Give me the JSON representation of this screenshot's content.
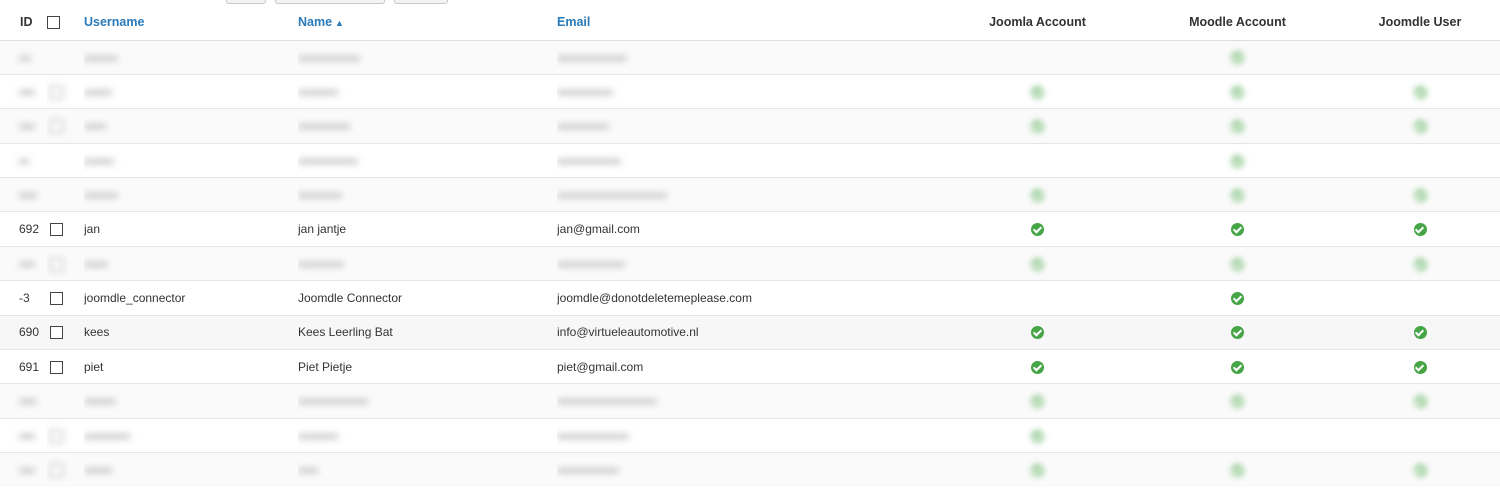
{
  "columns": {
    "id": "ID",
    "username": "Username",
    "name": "Name",
    "email": "Email",
    "joomla": "Joomla Account",
    "moodle": "Moodle Account",
    "joomdle": "Joomdle User"
  },
  "sort_icon": "caret-up-icon",
  "check_icon": "check-circle-icon",
  "colors": {
    "link": "#2a7ab9",
    "check": "#46a546"
  },
  "rows": [
    {
      "id": "",
      "username": "",
      "name": "",
      "email": "",
      "joomla": false,
      "moodle": true,
      "joomdle": false,
      "checkbox": false,
      "blurred": true
    },
    {
      "id": "",
      "username": "",
      "name": "",
      "email": "",
      "joomla": true,
      "moodle": true,
      "joomdle": true,
      "checkbox": true,
      "blurred": true
    },
    {
      "id": "",
      "username": "",
      "name": "",
      "email": "",
      "joomla": true,
      "moodle": true,
      "joomdle": true,
      "checkbox": true,
      "blurred": true
    },
    {
      "id": "",
      "username": "",
      "name": "",
      "email": "",
      "joomla": false,
      "moodle": true,
      "joomdle": false,
      "checkbox": false,
      "blurred": true
    },
    {
      "id": "",
      "username": "",
      "name": "",
      "email": "",
      "joomla": true,
      "moodle": true,
      "joomdle": true,
      "checkbox": false,
      "blurred": true
    },
    {
      "id": "692",
      "username": "jan",
      "name": "jan jantje",
      "email": "jan@gmail.com",
      "joomla": true,
      "moodle": true,
      "joomdle": true,
      "checkbox": true,
      "blurred": false
    },
    {
      "id": "",
      "username": "",
      "name": "",
      "email": "",
      "joomla": true,
      "moodle": true,
      "joomdle": true,
      "checkbox": true,
      "blurred": true
    },
    {
      "id": "-3",
      "username": "joomdle_connector",
      "name": "Joomdle Connector",
      "email": "joomdle@donotdeletemeplease.com",
      "joomla": false,
      "moodle": true,
      "joomdle": false,
      "checkbox": true,
      "blurred": false
    },
    {
      "id": "690",
      "username": "kees",
      "name": "Kees Leerling Bat",
      "email": "info@virtueleautomotive.nl",
      "joomla": true,
      "moodle": true,
      "joomdle": true,
      "checkbox": true,
      "blurred": false
    },
    {
      "id": "691",
      "username": "piet",
      "name": "Piet Pietje",
      "email": "piet@gmail.com",
      "joomla": true,
      "moodle": true,
      "joomdle": true,
      "checkbox": true,
      "blurred": false
    },
    {
      "id": "",
      "username": "",
      "name": "",
      "email": "",
      "joomla": true,
      "moodle": true,
      "joomdle": true,
      "checkbox": false,
      "blurred": true
    },
    {
      "id": "",
      "username": "",
      "name": "",
      "email": "",
      "joomla": true,
      "moodle": false,
      "joomdle": false,
      "checkbox": true,
      "blurred": true
    },
    {
      "id": "",
      "username": "",
      "name": "",
      "email": "",
      "joomla": true,
      "moodle": true,
      "joomdle": true,
      "checkbox": true,
      "blurred": true
    }
  ]
}
